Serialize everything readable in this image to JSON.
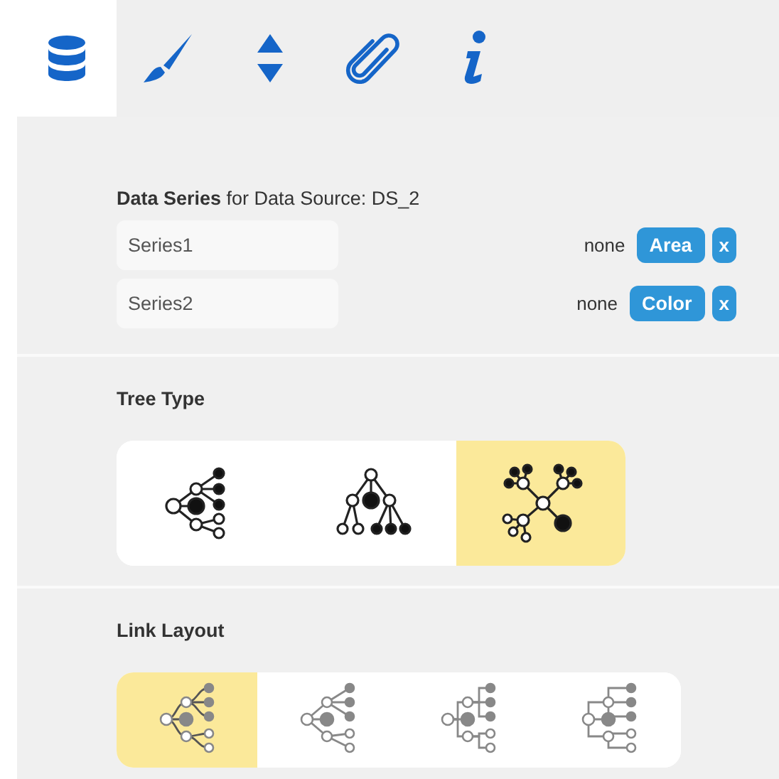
{
  "tabs": [
    {
      "kind": "database",
      "selected": true
    },
    {
      "kind": "brush",
      "selected": false
    },
    {
      "kind": "sort",
      "selected": false
    },
    {
      "kind": "paperclip",
      "selected": false
    },
    {
      "kind": "info",
      "selected": false
    }
  ],
  "data_series": {
    "heading": "**Data Series** for Data Source: DS_2",
    "rows": [
      {
        "name": "Series1",
        "mapping": "none",
        "role": "Area",
        "remove": "x"
      },
      {
        "name": "Series2",
        "mapping": "none",
        "role": "Color",
        "remove": "x"
      }
    ]
  },
  "tree_type": {
    "label": "Tree Type",
    "options": [
      {
        "kind": "horizontal",
        "selected": false
      },
      {
        "kind": "vertical",
        "selected": false
      },
      {
        "kind": "radial",
        "selected": true
      }
    ]
  },
  "link_layout": {
    "label": "Link Layout",
    "options": [
      {
        "kind": "curved",
        "selected": true
      },
      {
        "kind": "straight",
        "selected": false
      },
      {
        "kind": "elbow",
        "selected": false
      },
      {
        "kind": "step",
        "selected": false
      }
    ]
  }
}
